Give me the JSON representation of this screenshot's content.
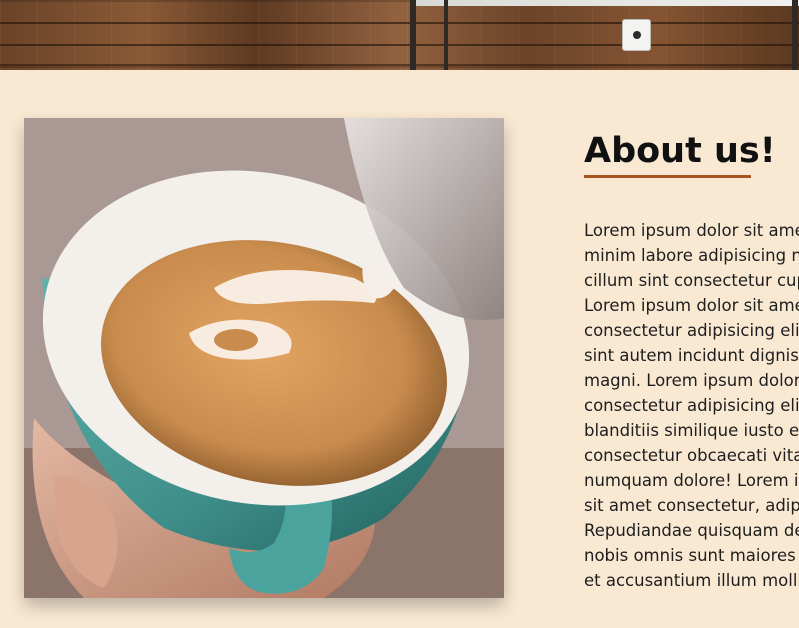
{
  "header_image": {
    "alt": "Wooden wall background",
    "icon": "power-socket-icon"
  },
  "about": {
    "image_alt": "Latte art in a teal coffee cup",
    "title": "About us!",
    "accent_color": "#a8551f",
    "lines": [
      "Lorem ipsum dolor sit ame",
      "minim labore adipisicing n",
      "cillum sint consectetur cup",
      "Lorem ipsum dolor sit ame",
      "consectetur adipisicing elit",
      "sint autem incidunt dignis",
      "magni. Lorem ipsum dolor",
      "consectetur adipisicing elit",
      "blanditiis similique iusto e",
      "consectetur obcaecati vita",
      "numquam dolore! Lorem i",
      "sit amet consectetur, adipi",
      "Repudiandae quisquam de",
      "nobis omnis sunt maiores",
      "et accusantium illum molli"
    ]
  },
  "colors": {
    "page_background": "#f9e9d3",
    "text": "#1e1e1e",
    "cup": "#4a9a96"
  }
}
